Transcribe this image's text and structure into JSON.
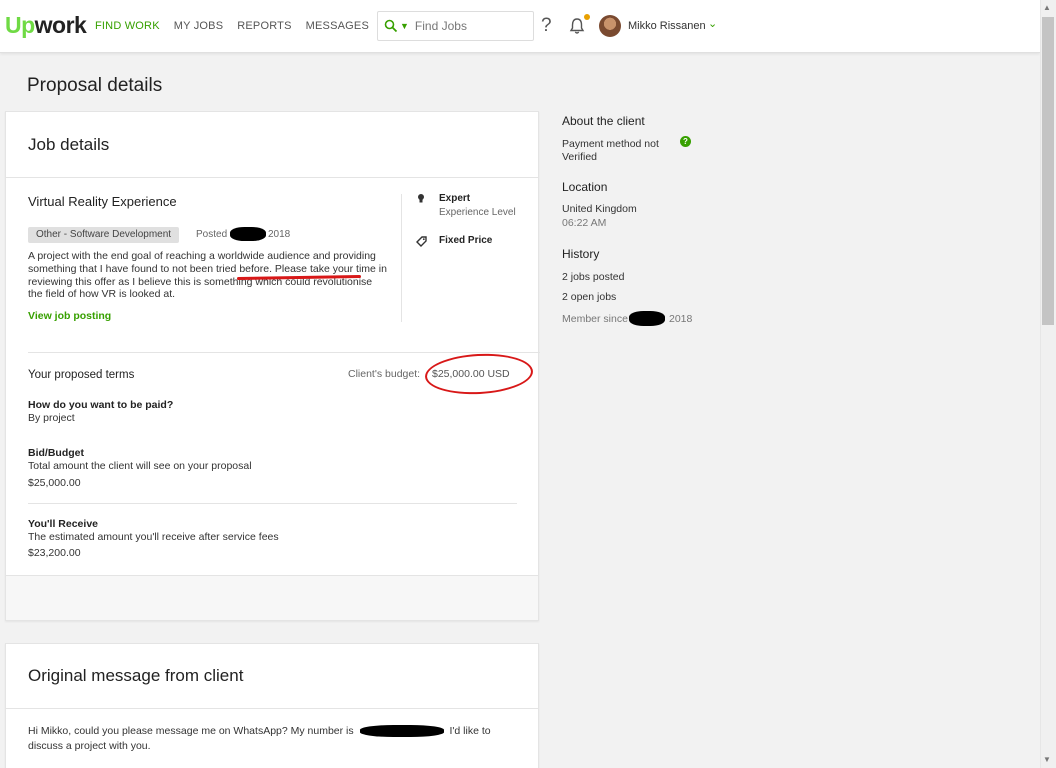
{
  "header": {
    "logo_up": "Up",
    "logo_work": "work",
    "nav": [
      {
        "label": "FIND WORK",
        "active": true
      },
      {
        "label": "MY JOBS"
      },
      {
        "label": "REPORTS"
      },
      {
        "label": "MESSAGES"
      }
    ],
    "search_placeholder": "Find Jobs",
    "help": "?",
    "user_name": "Mikko Rissanen",
    "accent": "#37a000"
  },
  "page": {
    "title": "Proposal details"
  },
  "job": {
    "card_title": "Job details",
    "title": "Virtual Reality Experience",
    "category": "Other - Software Development",
    "posted_label": "Posted",
    "posted_year": "2018",
    "description": "A project with the end goal of reaching a worldwide audience and providing something that I have found to not been tried before. Please take your time in reviewing this offer as I believe this is something which could revolutionise the field of how VR is looked at.",
    "view_link": "View job posting",
    "level": "Expert",
    "level_sub": "Experience Level",
    "price_type": "Fixed Price"
  },
  "terms": {
    "title": "Your proposed terms",
    "budget_label": "Client's budget:",
    "budget_value": "$25,000.00 USD",
    "paid_q": "How do you want to be paid?",
    "paid_a": "By project",
    "bid_q": "Bid/Budget",
    "bid_desc": "Total amount the client will see on your proposal",
    "bid_value": "$25,000.00",
    "receive_q": "You'll Receive",
    "receive_desc": "The estimated amount you'll receive after service fees",
    "receive_value": "$23,200.00"
  },
  "message": {
    "card_title": "Original message from client",
    "text_before": "Hi Mikko, could you please message me on WhatsApp? My number is",
    "text_after": "I'd like to discuss a project with you."
  },
  "client": {
    "about_title": "About the client",
    "payment": "Payment method not Verified",
    "location_title": "Location",
    "country": "United Kingdom",
    "time": "06:22 AM",
    "history_title": "History",
    "jobs_posted": "2 jobs posted",
    "open_jobs": "2 open jobs",
    "member_since": "Member since",
    "member_year": "2018"
  }
}
